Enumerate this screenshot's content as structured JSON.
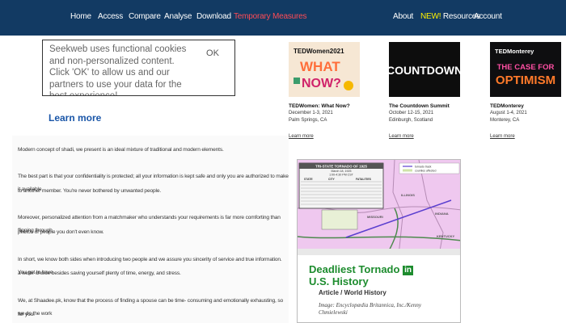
{
  "nav": {
    "left": [
      "Home",
      "Access",
      "Compare",
      "Analyse",
      "Download",
      "Temporary Measures"
    ],
    "new_prefix": "NEW!",
    "resources": "Resources",
    "about": "About",
    "account": "Account"
  },
  "colors": {
    "nav_bg": "#123a63",
    "active": "#ff4b55",
    "new_highlight": "#fff200",
    "link": "#1a56a8",
    "tornado_green": "#1d8c2e"
  },
  "cookie": {
    "text": "Seekweb uses functional cookies and non-personalized content. Click 'OK' to allow us and our partners to use your data for the best experience!",
    "ok": "OK",
    "learn_more": "Learn more"
  },
  "article": {
    "paragraphs": [
      "Modern concept of shadi, we present is an ideal mixture of traditional and modern elements.",
      "The best part is that your confidentiality is protected; all your information is kept safe and only you are authorized to make it available",
      "to another member. You're never bothered by unwanted people.",
      "Moreover, personalized attention from a matchmaker who understands your requirements is far more comforting than flipping through",
      "photos of people you don't even know.",
      "In short, we know both sides when introducing two people and we assure you sincerity of service and true information. You get to have",
      "a wider choice besides saving yourself plenty of time, energy, and stress.",
      "We, at Shaadee.pk, know that the process of finding a spouse can be time- consuming and emotionally exhausting, so we do the work",
      "for you."
    ]
  },
  "ted": [
    {
      "thumb": "TEDWomen 2021 / WHAT NOW?",
      "logo_line1": "TEDWomen2021",
      "logo_line2": "WHAT",
      "logo_line3": "NOW?",
      "title": "TEDWomen: What Now?",
      "dates": "December 1-3, 2021",
      "place": "Palm Springs, CA",
      "link": "Learn more"
    },
    {
      "thumb": "COUNTDOWN",
      "logo_line1": "COUNTDOWN",
      "title": "The Countdown Summit",
      "dates": "October 12-15, 2021",
      "place": "Edinburgh, Scotland",
      "link": "Learn more"
    },
    {
      "thumb": "TEDMonterey THE CASE FOR OPTIMISM",
      "logo_line1": "TEDMonterey",
      "logo_line2": "THE CASE FOR",
      "logo_line3": "OPTIMISM",
      "title": "TEDMonterey",
      "dates": "August 1-4, 2021",
      "place": "Monterey, CA",
      "link": "Learn more"
    }
  ],
  "tornado": {
    "table_title": "TRI-STATE TORNADO OF 1925",
    "table_date": "March 18, 1925",
    "table_time": "1:00-4:30 PM CST",
    "table_cols": [
      "STATE",
      "CITY",
      "FATALITIES"
    ],
    "legend": [
      "tornado track",
      "counties affected"
    ],
    "states": [
      "ILLINOIS",
      "INDIANA",
      "MISSOURI",
      "KENTUCKY"
    ],
    "title_line1": "Deadliest Tornado",
    "title_line2": "U.S. History",
    "in_badge": "in",
    "subtitle": "Article / World History",
    "credit": "Image: Encyclopædia Britannica, Inc./Kenny Chmielewski"
  }
}
